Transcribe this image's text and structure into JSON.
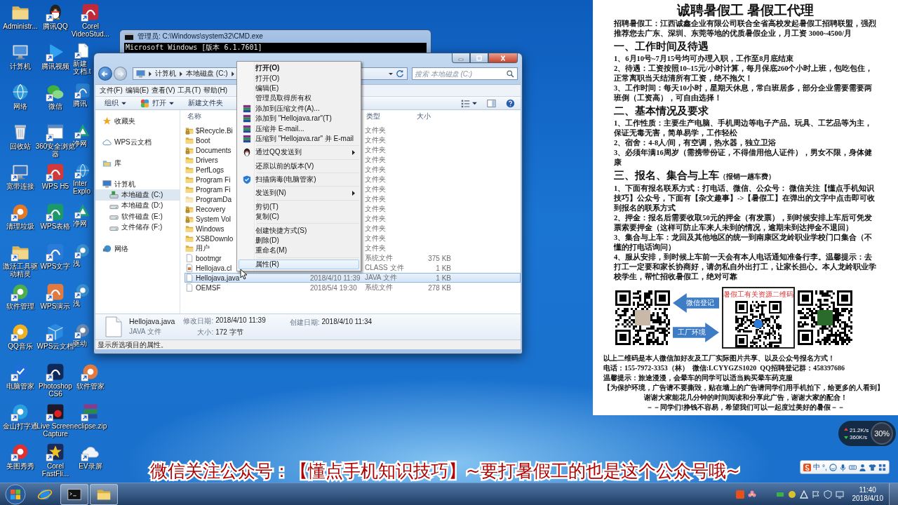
{
  "desktop": {
    "icons": [
      {
        "label": "Administr...",
        "kind": "plain"
      },
      {
        "label": "计算机",
        "kind": "plain"
      },
      {
        "label": "网络",
        "kind": "plain"
      },
      {
        "label": "回收站",
        "kind": "plain"
      },
      {
        "label": "宽带连接",
        "kind": "shortcut"
      },
      {
        "label": "清理垃圾",
        "kind": "shortcut"
      },
      {
        "label": "激活工具驱动精灵",
        "kind": "shortcut"
      },
      {
        "label": "软件管理",
        "kind": "shortcut"
      },
      {
        "label": "QQ音乐",
        "kind": "shortcut"
      },
      {
        "label": "电脑管家",
        "kind": "shortcut"
      },
      {
        "label": "金山打字通",
        "kind": "shortcut"
      },
      {
        "label": "美图秀秀",
        "kind": "shortcut"
      },
      {
        "label": "腾讯QQ",
        "kind": "shortcut"
      },
      {
        "label": "腾讯视频",
        "kind": "shortcut"
      },
      {
        "label": "微信",
        "kind": "shortcut"
      },
      {
        "label": "360安全浏览器",
        "kind": "shortcut"
      },
      {
        "label": "WPS H5",
        "kind": "shortcut"
      },
      {
        "label": "WPS表格",
        "kind": "shortcut"
      },
      {
        "label": "WPS文字",
        "kind": "shortcut"
      },
      {
        "label": "WPS演示",
        "kind": "shortcut"
      },
      {
        "label": "WPS云文档",
        "kind": "shortcut"
      },
      {
        "label": "Photoshop CS6",
        "kind": "shortcut"
      },
      {
        "label": "Live Screen Capture",
        "kind": "shortcut"
      },
      {
        "label": "Corel FastFli...",
        "kind": "shortcut"
      },
      {
        "label": "Corel VideoStud...",
        "kind": "shortcut"
      },
      {
        "label": "新建文档.t",
        "kind": "covered"
      },
      {
        "label": "腾讯",
        "kind": "covered"
      },
      {
        "label": "净网",
        "kind": "covered"
      },
      {
        "label": "Inter Explo",
        "kind": "covered"
      },
      {
        "label": "净网",
        "kind": "covered"
      },
      {
        "label": "浅",
        "kind": "covered"
      },
      {
        "label": "浅",
        "kind": "covered"
      },
      {
        "label": "驱动",
        "kind": "covered"
      },
      {
        "label": "软件管家",
        "kind": "shortcut"
      },
      {
        "label": "eclipse.zip",
        "kind": "shortcut"
      },
      {
        "label": "EV录屏",
        "kind": "shortcut"
      }
    ]
  },
  "cmd_window": {
    "title": "管理员: C:\\Windows\\system32\\CMD.exe",
    "lines": [
      "Microsoft Windows [版本 6.1.7601]"
    ]
  },
  "explorer": {
    "breadcrumb": [
      "计算机",
      "本地磁盘 (C:)"
    ],
    "search": {
      "placeholder": "搜索 本地磁盘 (C:)"
    },
    "menu": [
      "文件(F)",
      "编辑(E)",
      "查看(V)",
      "工具(T)",
      "帮助(H)"
    ],
    "toolbar": [
      {
        "label": "组织",
        "dropdown": true
      },
      {
        "label": "打开",
        "dropdown": true
      },
      {
        "label": "新建文件夹",
        "dropdown": false
      }
    ],
    "nav": [
      {
        "label": "收藏夹",
        "selected": false
      },
      {
        "label": "WPS云文档",
        "selected": false
      },
      {
        "label": "库",
        "selected": false
      },
      {
        "label": "计算机",
        "selected": false,
        "children": [
          {
            "label": "本地磁盘 (C:)",
            "selected": true
          },
          {
            "label": "本地磁盘 (D:)",
            "selected": false
          },
          {
            "label": "软件磁盘 (E:)",
            "selected": false
          },
          {
            "label": "文件储存 (F:)",
            "selected": false
          }
        ]
      },
      {
        "label": "网络",
        "selected": false
      }
    ],
    "columns": [
      "名称",
      "类型",
      "大小"
    ],
    "rows": [
      {
        "name": "$Recycle.Bi",
        "kind": "protected",
        "type": "文件夹",
        "selected": false
      },
      {
        "name": "Boot",
        "kind": "folder",
        "type": "文件夹",
        "selected": false
      },
      {
        "name": "Documents",
        "kind": "protected",
        "type": "文件夹",
        "selected": false
      },
      {
        "name": "Drivers",
        "kind": "folder",
        "type": "文件夹",
        "selected": false
      },
      {
        "name": "PerfLogs",
        "kind": "folder",
        "type": "文件夹",
        "selected": false
      },
      {
        "name": "Program Fi",
        "kind": "folder",
        "type": "文件夹",
        "selected": false
      },
      {
        "name": "Program Fi",
        "kind": "folder",
        "type": "文件夹",
        "selected": false
      },
      {
        "name": "ProgramDa",
        "kind": "hidden",
        "type": "文件夹",
        "selected": false
      },
      {
        "name": "Recovery",
        "kind": "protected",
        "type": "文件夹",
        "selected": false
      },
      {
        "name": "System Vol",
        "kind": "protected",
        "type": "文件夹",
        "selected": false
      },
      {
        "name": "Windows",
        "kind": "folder",
        "type": "文件夹",
        "selected": false
      },
      {
        "name": "XSBDownlo",
        "kind": "folder",
        "type": "文件夹",
        "selected": false
      },
      {
        "name": "用户",
        "kind": "folder",
        "type": "文件夹",
        "selected": false
      },
      {
        "name": "bootmgr",
        "kind": "file",
        "type": "系统文件",
        "size": "375 KB",
        "selected": false
      },
      {
        "name": "Hellojava.cl",
        "kind": "classfile",
        "type": "CLASS 文件",
        "size": "1 KB",
        "selected": false
      },
      {
        "name": "Hellojava.java",
        "kind": "file",
        "date": "2018/4/10 11:39",
        "type": "JAVA 文件",
        "size": "1 KB",
        "selected": true
      },
      {
        "name": "OEMSF",
        "kind": "file",
        "date": "2018/5/4 19:30",
        "type": "系统文件",
        "size": "278 KB",
        "selected": false
      }
    ],
    "details": {
      "name": "Hellojava.java",
      "type": "JAVA 文件",
      "fields": [
        {
          "label": "修改日期:",
          "value": "2018/4/10 11:39"
        },
        {
          "label": "大小:",
          "value": "172 字节"
        },
        {
          "label": "创建日期:",
          "value": "2018/4/10 11:34"
        }
      ]
    },
    "status_bar": "显示所选项目的属性。"
  },
  "context_menu": {
    "groups": [
      [
        {
          "label": "打开(O)",
          "default": true,
          "submenu": false,
          "selected": false
        },
        {
          "label": "打开(O)",
          "default": false,
          "submenu": false,
          "selected": false
        },
        {
          "label": "编辑(E)",
          "default": false,
          "submenu": false,
          "selected": false
        },
        {
          "label": "管理员取得所有权",
          "default": false,
          "submenu": false,
          "selected": false
        },
        {
          "label": "添加到压缩文件(A)...",
          "default": false,
          "submenu": false,
          "selected": false
        },
        {
          "label": "添加到 \"Hellojava.rar\"(T)",
          "default": false,
          "submenu": false,
          "selected": false
        },
        {
          "label": "压缩并 E-mail...",
          "default": false,
          "submenu": false,
          "selected": false
        },
        {
          "label": "压缩到 \"Hellojava.rar\" 并 E-mail",
          "default": false,
          "submenu": false,
          "selected": false
        }
      ],
      [
        {
          "label": "通过QQ发送到",
          "default": false,
          "submenu": true,
          "selected": false
        }
      ],
      [
        {
          "label": "还原以前的版本(V)",
          "default": false,
          "submenu": false,
          "selected": false
        }
      ],
      [
        {
          "label": "扫描病毒(电脑管家)",
          "default": false,
          "submenu": false,
          "selected": false
        }
      ],
      [
        {
          "label": "发送到(N)",
          "default": false,
          "submenu": true,
          "selected": false
        }
      ],
      [
        {
          "label": "剪切(T)",
          "default": false,
          "submenu": false,
          "selected": false
        },
        {
          "label": "复制(C)",
          "default": false,
          "submenu": false,
          "selected": false
        }
      ],
      [
        {
          "label": "创建快捷方式(S)",
          "default": false,
          "submenu": false,
          "selected": false
        },
        {
          "label": "删除(D)",
          "default": false,
          "submenu": false,
          "selected": false
        },
        {
          "label": "重命名(M)",
          "default": false,
          "submenu": false,
          "selected": false
        }
      ],
      [
        {
          "label": "属性(R)",
          "default": false,
          "submenu": false,
          "selected": true
        }
      ]
    ]
  },
  "poster": {
    "title": "诚聘暑假工 暑假工代理",
    "blocks": [
      {
        "kind": "para",
        "text": "招聘暑假工：江西诚鑫企业有限公司联合全省高校发起暑假工招聘联盟，强烈推荐您去广东、深圳、东莞等地的优质暑假企业，月工资 3000~4500/月"
      },
      {
        "kind": "heading",
        "text": "一、工作时间及待遇"
      },
      {
        "kind": "para",
        "text": "1、6月10号~7月15号均可办理入职，工作至8月底结束"
      },
      {
        "kind": "para",
        "text": "2、待遇：工资按照10~15元/小时计算，每月保底260个小时上班，包吃包住，正常离职当天结清所有工资，绝不拖欠！"
      },
      {
        "kind": "para",
        "text": "3、工作时间：每天10小时，星期天休息，常白班居多，部分企业需要需要两班倒（工资高），可自由选择！"
      },
      {
        "kind": "heading",
        "text": "二、基本情况及要求"
      },
      {
        "kind": "para",
        "text": "1、工作性质：主要生产电脑、手机周边等电子产品。玩具、工艺品等为主，保证无毒无害，简单易学，工作轻松"
      },
      {
        "kind": "para",
        "text": "2、宿舍：4-8人/间，有空调，热水器，独立卫浴"
      },
      {
        "kind": "para",
        "text": "3、必须年满16周岁（需携带份证，不得借用他人证件），男女不限，身体健康"
      },
      {
        "kind": "heading",
        "text": "三、报名、集合与上车",
        "note": "（报销一趟车费）"
      },
      {
        "kind": "para",
        "text": "1、下面有报名联系方式：打电话、微信、公众号： 微信关注【懂点手机知识技巧】公众号，下面有【杂文趣事】->【暑假工】在弹出的文字中点击即可收到报名的联系方式"
      },
      {
        "kind": "para",
        "text": "2、押金：报名后需要收取50元的押金（有发票），到时候安排上车后可凭发票索要押金（这样可防止车来人未到的情况，逾期未到达押金不退回）"
      },
      {
        "kind": "para",
        "text": "3、集合与上车：龙回及其他地区的统一到南康区龙岭职业学校门口集合（不懂的打电话询问）"
      },
      {
        "kind": "para",
        "text": "4、服从安排，到时候上车前一天会有本人电话通知准备行李。温馨提示：去打工一定要和家长协商好，请勿私自外出打工，让家长担心。本人龙岭职业学校学生，帮忙招收暑假工，绝对可靠"
      },
      {
        "kind": "qr",
        "arrows": [
          "微信登记",
          "工厂环境"
        ],
        "caption": "暑假工有关资源二维码"
      },
      {
        "kind": "line",
        "text": "以上二维码是本人微信加好友及工厂实际图片共享、以及公众号报名方式！"
      },
      {
        "kind": "line",
        "text": "电话：155-7972-3353（林）  微信:LCYYGZS1020  QQ招聘登记群：458397686"
      },
      {
        "kind": "line",
        "text": "温馨提示：旅途漫漫，会晕车的同学可以适当购买晕车药克服"
      },
      {
        "kind": "line",
        "text": "【为保护环境，广告请不要撕毁，贴在墙上的广告请同学们用手机拍下，给更多的人看到】"
      },
      {
        "kind": "center",
        "text": "谢谢大家能花几分钟的时间阅读和分享此广告，谢谢大家的配合！"
      },
      {
        "kind": "center",
        "text": "－－同学们!挣钱不容易，希望我们可以一起度过美好的暑假－－"
      }
    ]
  },
  "speed_widget": {
    "up": "21.2K/s",
    "down": "360K/s",
    "usage": "30%"
  },
  "ime_bar": {
    "labels": [
      "中",
      "°,"
    ]
  },
  "caption": "微信关注公众号：【懂点手机知识技巧】~要打暑假工的也是这个公众号哦~",
  "taskbar": {
    "buttons": [
      {
        "running": false
      },
      {
        "running": true
      },
      {
        "running": true
      }
    ],
    "time": "11:40",
    "date": "2018/4/10"
  }
}
